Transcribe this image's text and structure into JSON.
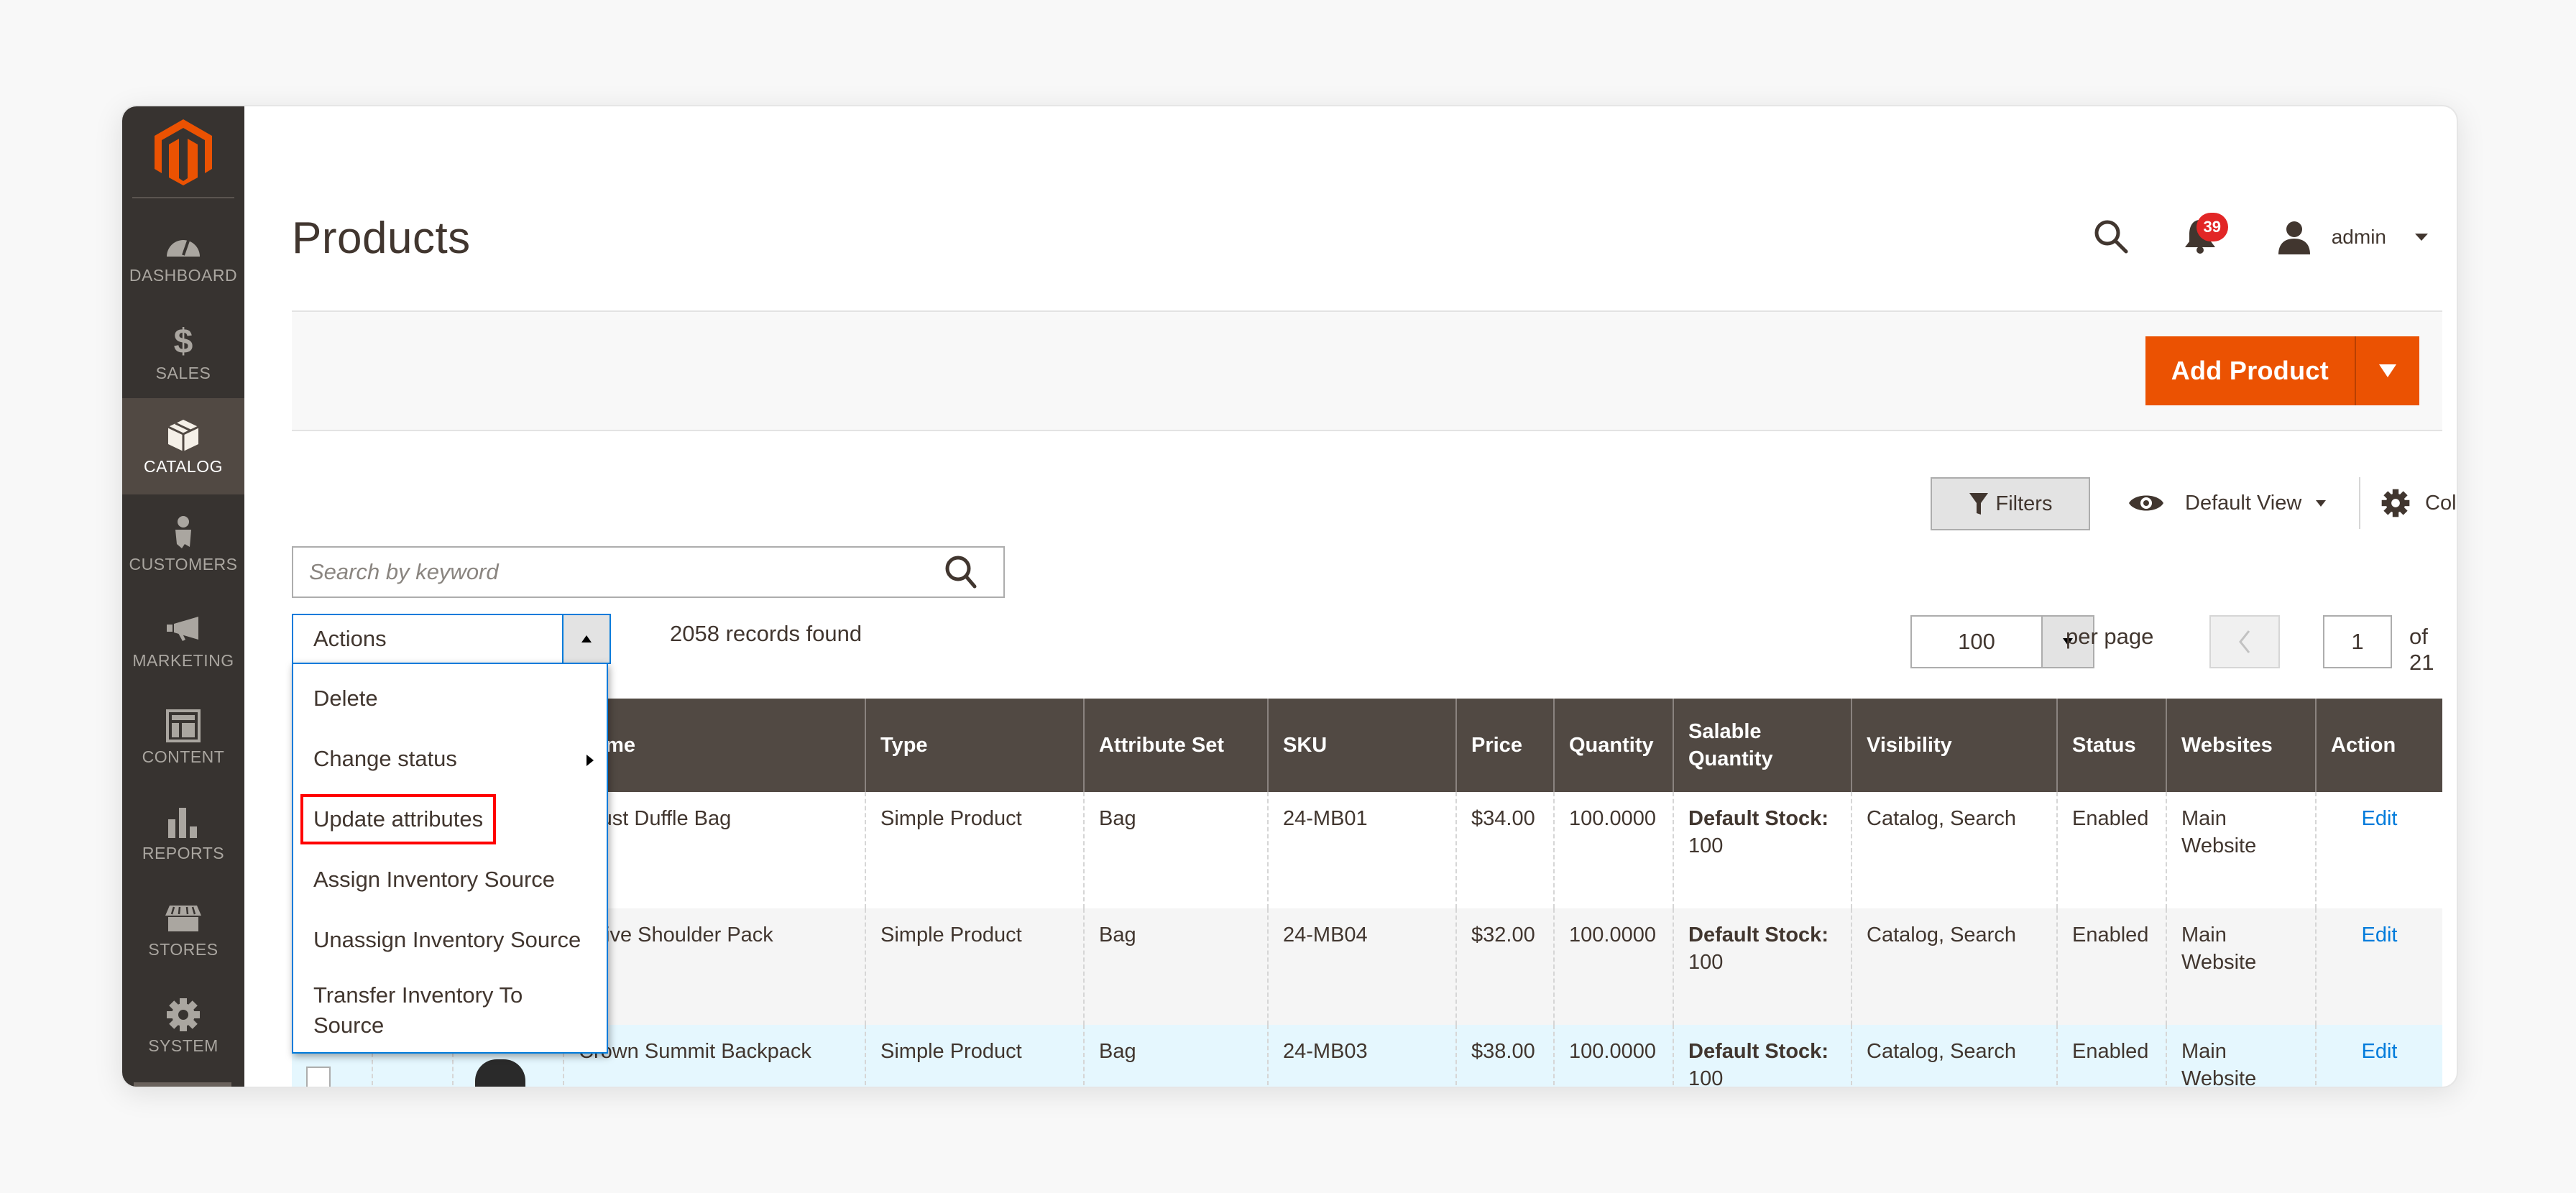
{
  "sidebar": {
    "items": [
      {
        "label": "DASHBOARD",
        "icon": "dashboard-gauge-icon",
        "active": false
      },
      {
        "label": "SALES",
        "icon": "dollar-icon",
        "active": false
      },
      {
        "label": "CATALOG",
        "icon": "box-icon",
        "active": true
      },
      {
        "label": "CUSTOMERS",
        "icon": "person-icon",
        "active": false
      },
      {
        "label": "MARKETING",
        "icon": "megaphone-icon",
        "active": false
      },
      {
        "label": "CONTENT",
        "icon": "layout-icon",
        "active": false
      },
      {
        "label": "REPORTS",
        "icon": "bar-chart-icon",
        "active": false
      },
      {
        "label": "STORES",
        "icon": "storefront-icon",
        "active": false
      },
      {
        "label": "SYSTEM",
        "icon": "gear-icon",
        "active": false
      }
    ]
  },
  "header": {
    "title": "Products",
    "notifications_count": "39",
    "user_name": "admin"
  },
  "page_actions": {
    "add_product_label": "Add Product"
  },
  "toolbar": {
    "filters_label": "Filters",
    "view_label": "Default View",
    "columns_label": "Columns",
    "search_placeholder": "Search by keyword",
    "search_value": "",
    "actions_label": "Actions",
    "records_found": "2058 records found",
    "per_page_value": "100",
    "per_page_label": "per page",
    "current_page": "1",
    "total_pages_label": "of 21"
  },
  "actions_menu": {
    "items": [
      {
        "label": "Delete",
        "has_submenu": false,
        "highlighted": false
      },
      {
        "label": "Change status",
        "has_submenu": true,
        "highlighted": false
      },
      {
        "label": "Update attributes",
        "has_submenu": false,
        "highlighted": true
      },
      {
        "label": "Assign Inventory Source",
        "has_submenu": false,
        "highlighted": false
      },
      {
        "label": "Unassign Inventory Source",
        "has_submenu": false,
        "highlighted": false
      },
      {
        "label": "Transfer Inventory To Source",
        "has_submenu": false,
        "highlighted": false
      }
    ]
  },
  "grid": {
    "columns": [
      "",
      "",
      "",
      "Name",
      "Type",
      "Attribute Set",
      "SKU",
      "Price",
      "Quantity",
      "Salable Quantity",
      "Visibility",
      "Status",
      "Websites",
      "Action"
    ],
    "rows": [
      {
        "name": "Joust Duffle Bag",
        "type": "Simple Product",
        "attribute_set": "Bag",
        "sku": "24-MB01",
        "price": "$34.00",
        "quantity": "100.0000",
        "salable_label": "Default Stock",
        "salable_value": "100",
        "visibility": "Catalog, Search",
        "status": "Enabled",
        "websites": "Main Website",
        "action": "Edit"
      },
      {
        "name": "Strive Shoulder Pack",
        "type": "Simple Product",
        "attribute_set": "Bag",
        "sku": "24-MB04",
        "price": "$32.00",
        "quantity": "100.0000",
        "salable_label": "Default Stock",
        "salable_value": "100",
        "visibility": "Catalog, Search",
        "status": "Enabled",
        "websites": "Main Website",
        "action": "Edit"
      },
      {
        "name": "Crown Summit Backpack",
        "type": "Simple Product",
        "attribute_set": "Bag",
        "sku": "24-MB03",
        "price": "$38.00",
        "quantity": "100.0000",
        "salable_label": "Default Stock",
        "salable_value": "100",
        "visibility": "Catalog, Search",
        "status": "Enabled",
        "websites": "Main Website",
        "action": "Edit"
      }
    ]
  },
  "colors": {
    "brand_orange": "#eb5202",
    "sidebar_bg": "#373330",
    "sidebar_active": "#514943",
    "table_header": "#514943",
    "link_blue": "#007bdb",
    "badge_red": "#e22626",
    "highlight_red": "#ff0000"
  }
}
